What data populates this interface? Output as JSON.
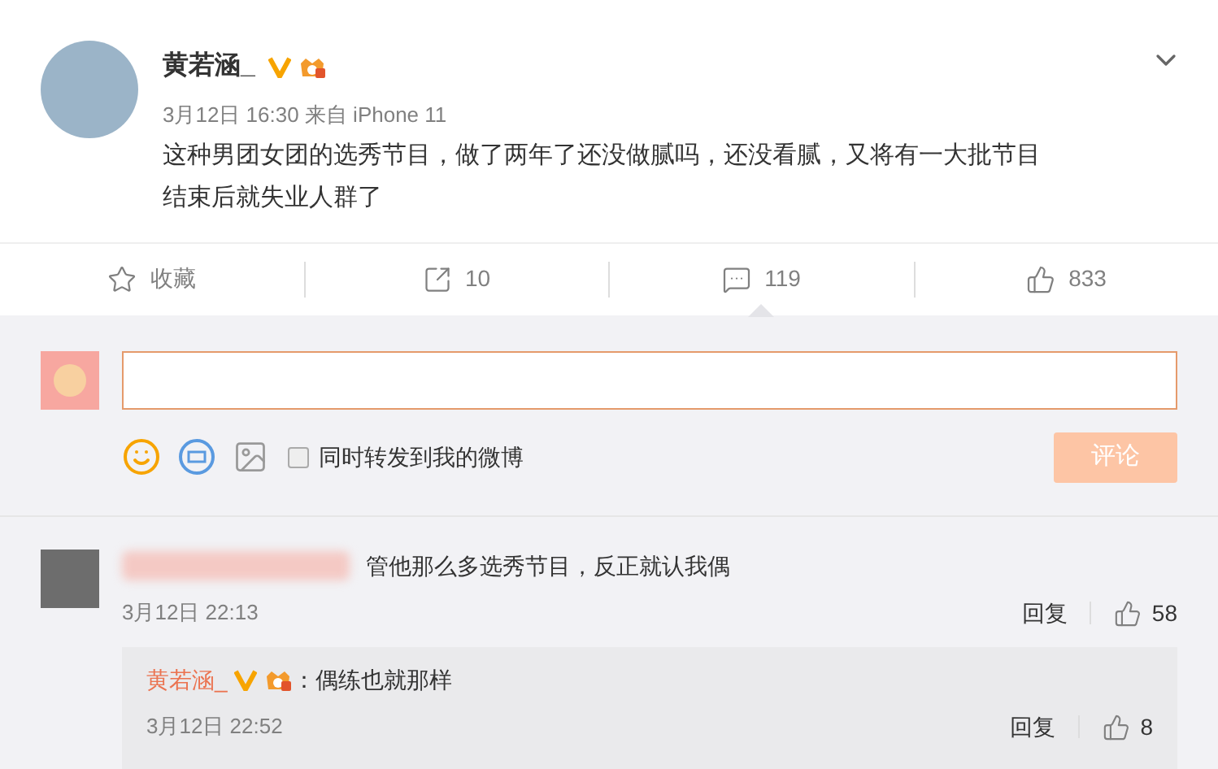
{
  "post": {
    "author": "黄若涵_",
    "meta": "3月12日 16:30 来自 iPhone 11",
    "text": "这种男团女团的选秀节目，做了两年了还没做腻吗，还没看腻，又将有一大批节目结束后就失业人群了"
  },
  "actions": [
    {
      "kind": "star",
      "label": "收藏",
      "selected": false
    },
    {
      "kind": "share",
      "label": "10",
      "selected": false
    },
    {
      "kind": "comment",
      "label": "119",
      "selected": true
    },
    {
      "kind": "like",
      "label": "833",
      "selected": false
    }
  ],
  "composer": {
    "options": [
      {
        "label": "同时转发到我的微博",
        "checked": false
      }
    ],
    "submit": {
      "label": "评论",
      "disabled": true
    }
  },
  "comments": [
    {
      "text": "管他那么多选秀节目，反正就认我偶",
      "time": "3月12日 22:13",
      "reply": "回复",
      "likes": "58",
      "replies": [
        {
          "author": "黄若涵_",
          "text": "：偶练也就那样",
          "time": "3月12日 22:52",
          "reply": "回复",
          "likes": "8"
        }
      ]
    }
  ]
}
